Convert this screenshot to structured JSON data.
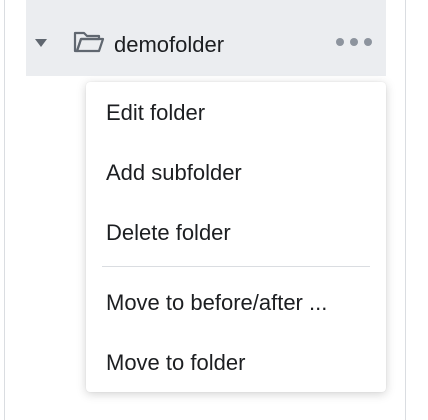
{
  "folder": {
    "name": "demofolder",
    "icon": "folder-open-icon",
    "caret_icon": "caret-down-icon",
    "more_icon": "more-horizontal-icon"
  },
  "menu": {
    "items": [
      {
        "label": "Edit folder"
      },
      {
        "label": "Add subfolder"
      },
      {
        "label": "Delete folder"
      },
      {
        "label": "Move to before/after ..."
      },
      {
        "label": "Move to folder"
      }
    ]
  },
  "colors": {
    "row_background": "#ebedf0",
    "text": "#1c1e21",
    "icon": "#606770",
    "divider": "#dadde1"
  }
}
